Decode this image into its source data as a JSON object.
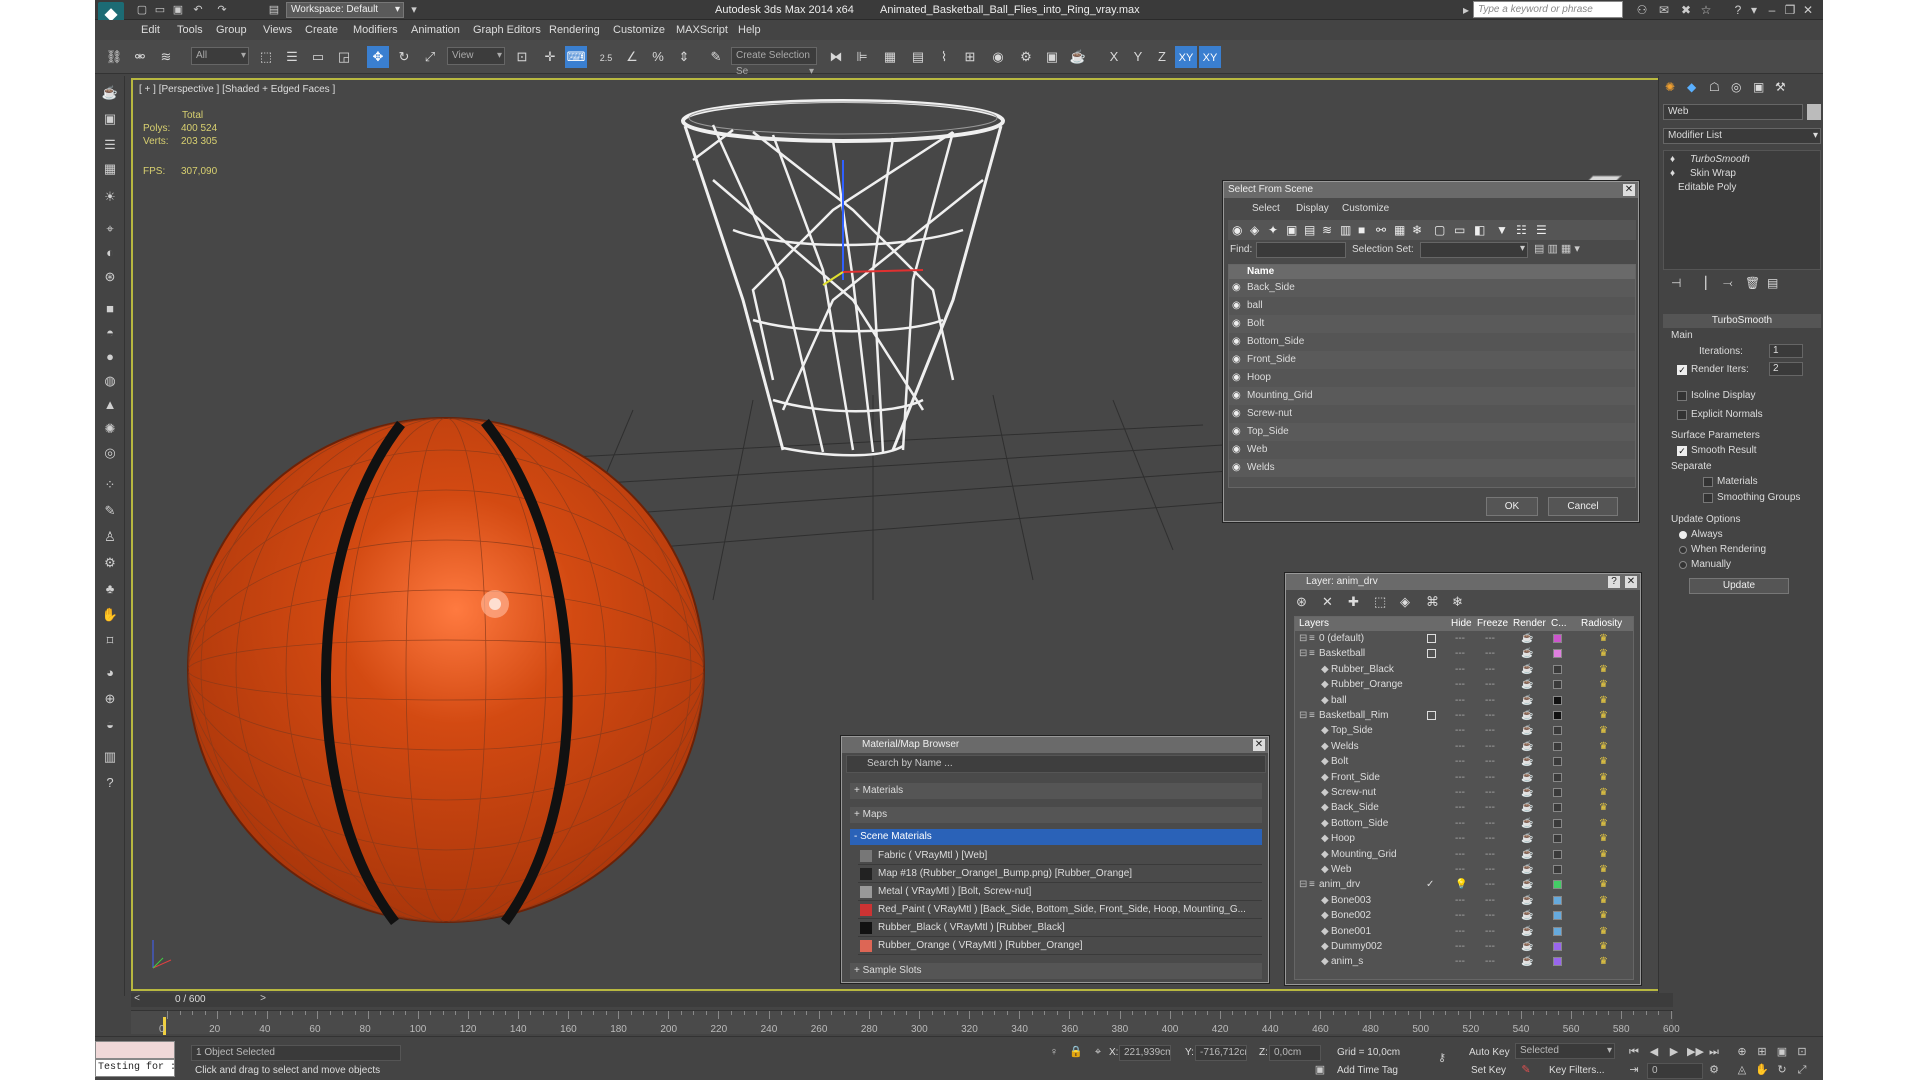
{
  "title": {
    "workspace": "Workspace: Default",
    "app_name": "Autodesk 3ds Max  2014 x64",
    "file_name": "Animated_Basketball_Ball_Flies_into_Ring_vray.max",
    "search_placeholder": "Type a keyword or phrase"
  },
  "menu": [
    "Edit",
    "Tools",
    "Group",
    "Views",
    "Create",
    "Modifiers",
    "Animation",
    "Graph Editors",
    "Rendering",
    "Customize",
    "MAXScript",
    "Help"
  ],
  "toolbar": {
    "filter_value": "All",
    "refcoord_value": "View",
    "selection_set_placeholder": "Create Selection Se",
    "snap_angle": "2.5",
    "axes": [
      "X",
      "Y",
      "Z",
      "XY",
      "XY"
    ]
  },
  "viewport": {
    "label": "[ + ] [Perspective ] [Shaded + Edged Faces ]",
    "stats_total": "Total",
    "polys_label": "Polys:",
    "polys_value": "400 524",
    "verts_label": "Verts:",
    "verts_value": "203 305",
    "fps_label": "FPS:",
    "fps_value": "307,090"
  },
  "select_from_scene": {
    "title": "Select From Scene",
    "tabs": [
      "Select",
      "Display",
      "Customize"
    ],
    "find_label": "Find:",
    "selection_set_label": "Selection Set:",
    "column_name": "Name",
    "items": [
      "Back_Side",
      "ball",
      "Bolt",
      "Bottom_Side",
      "Front_Side",
      "Hoop",
      "Mounting_Grid",
      "Screw-nut",
      "Top_Side",
      "Web",
      "Welds"
    ],
    "ok": "OK",
    "cancel": "Cancel"
  },
  "material_browser": {
    "title": "Material/Map Browser",
    "search_placeholder": "Search by Name ...",
    "materials_group": "+ Materials",
    "maps_group": "+ Maps",
    "scene_materials_group": "- Scene Materials",
    "entries": [
      "Fabric  ( VRayMtl ) [Web]",
      "Map #18 (Rubber_OrangeI_Bump.png) [Rubber_Orange]",
      "Metal  ( VRayMtl ) [Bolt, Screw-nut]",
      "Red_Paint  ( VRayMtl ) [Back_Side, Bottom_Side, Front_Side, Hoop, Mounting_G...",
      "Rubber_Black  ( VRayMtl ) [Rubber_Black]",
      "Rubber_Orange  ( VRayMtl ) [Rubber_Orange]"
    ],
    "sample_slots_group": "+ Sample Slots"
  },
  "layer_dialog": {
    "title": "Layer: anim_drv",
    "columns": [
      "Layers",
      "Hide",
      "Freeze",
      "Render",
      "C...",
      "Radiosity"
    ],
    "rows": [
      {
        "name": "0 (default)",
        "level": 0,
        "color": "#cc55cc"
      },
      {
        "name": "Basketball",
        "level": 0,
        "color": "#e080e0"
      },
      {
        "name": "Rubber_Black",
        "level": 1,
        "color": "#3a3a3a"
      },
      {
        "name": "Rubber_Orange",
        "level": 1,
        "color": "#3a3a3a"
      },
      {
        "name": "ball",
        "level": 1,
        "color": "#111111"
      },
      {
        "name": "Basketball_Rim",
        "level": 0,
        "color": "#111111"
      },
      {
        "name": "Top_Side",
        "level": 1,
        "color": "#3a3a3a"
      },
      {
        "name": "Welds",
        "level": 1,
        "color": "#3a3a3a"
      },
      {
        "name": "Bolt",
        "level": 1,
        "color": "#3a3a3a"
      },
      {
        "name": "Front_Side",
        "level": 1,
        "color": "#3a3a3a"
      },
      {
        "name": "Screw-nut",
        "level": 1,
        "color": "#3a3a3a"
      },
      {
        "name": "Back_Side",
        "level": 1,
        "color": "#3a3a3a"
      },
      {
        "name": "Bottom_Side",
        "level": 1,
        "color": "#3a3a3a"
      },
      {
        "name": "Hoop",
        "level": 1,
        "color": "#3a3a3a"
      },
      {
        "name": "Mounting_Grid",
        "level": 1,
        "color": "#3a3a3a"
      },
      {
        "name": "Web",
        "level": 1,
        "color": "#3a3a3a"
      },
      {
        "name": "anim_drv",
        "level": 0,
        "color": "#44cc66"
      },
      {
        "name": "Bone003",
        "level": 1,
        "color": "#66aadd"
      },
      {
        "name": "Bone002",
        "level": 1,
        "color": "#66aadd"
      },
      {
        "name": "Bone001",
        "level": 1,
        "color": "#66aadd"
      },
      {
        "name": "Dummy002",
        "level": 1,
        "color": "#9966ee"
      },
      {
        "name": "anim_s",
        "level": 1,
        "color": "#9966ee"
      }
    ]
  },
  "command_panel": {
    "object_name": "Web",
    "modifier_list": "Modifier List",
    "stack": [
      "TurboSmooth",
      "Skin Wrap",
      "Editable Poly"
    ],
    "rollout_title": "TurboSmooth",
    "main_label": "Main",
    "iterations_label": "Iterations:",
    "iterations_value": "1",
    "render_iters_label": "Render Iters:",
    "render_iters_value": "2",
    "isoline_display": "Isoline Display",
    "explicit_normals": "Explicit Normals",
    "surface_params": "Surface Parameters",
    "smooth_result": "Smooth Result",
    "separate": "Separate",
    "materials": "Materials",
    "smoothing_groups": "Smoothing Groups",
    "update_options": "Update Options",
    "always": "Always",
    "when_rendering": "When Rendering",
    "manually": "Manually",
    "update_button": "Update"
  },
  "timeline": {
    "frame_display": "0 / 600",
    "labels": [
      "0",
      "20",
      "40",
      "60",
      "80",
      "100",
      "120",
      "140",
      "160",
      "180",
      "200",
      "220",
      "240",
      "260",
      "280",
      "300",
      "320",
      "340",
      "360",
      "380",
      "400",
      "420",
      "440",
      "460",
      "480",
      "500",
      "520",
      "540",
      "560",
      "580",
      "600"
    ]
  },
  "statusbar": {
    "maxscript": "Testing for :",
    "selected": "1 Object Selected",
    "prompt": "Click and drag to select and move objects",
    "x_label": "X:",
    "x_value": "221,939cm",
    "y_label": "Y:",
    "y_value": "-716,712cr",
    "z_label": "Z:",
    "z_value": "0,0cm",
    "grid": "Grid = 10,0cm",
    "add_time_tag": "Add Time Tag",
    "auto_key": "Auto Key",
    "set_key": "Set Key",
    "selected_dd": "Selected",
    "key_filters": "Key Filters...",
    "frame_value": "0"
  }
}
